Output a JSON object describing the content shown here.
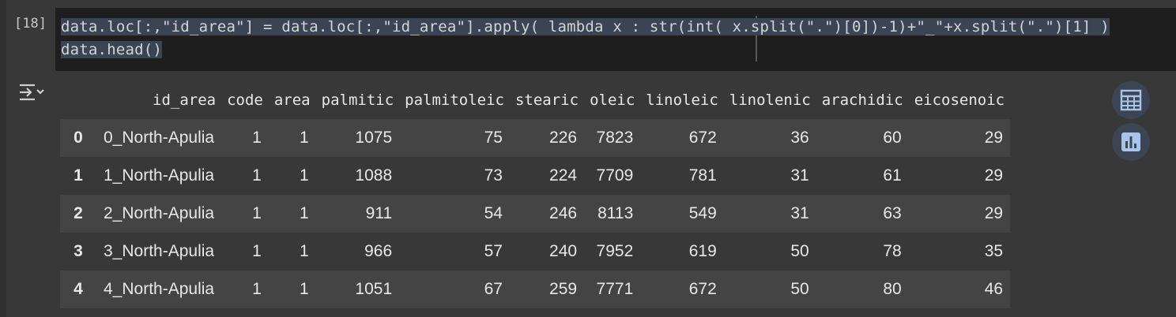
{
  "cell": {
    "execution_count": "[18]",
    "code_line_1": "data.loc[:,\"id_area\"] = data.loc[:,\"id_area\"].apply( lambda x : str(int( x.split(\".\")[0])-1)+\"_\"+x.split(\".\")[1] )",
    "code_line_2": "data.head()"
  },
  "output": {
    "toggle_icon": "output-collapse-icon",
    "columns": [
      "",
      "id_area",
      "code",
      "area",
      "palmitic",
      "palmitoleic",
      "stearic",
      "oleic",
      "linoleic",
      "linolenic",
      "arachidic",
      "eicosenoic"
    ],
    "rows": [
      [
        "0",
        "0_North-Apulia",
        "1",
        "1",
        "1075",
        "75",
        "226",
        "7823",
        "672",
        "36",
        "60",
        "29"
      ],
      [
        "1",
        "1_North-Apulia",
        "1",
        "1",
        "1088",
        "73",
        "224",
        "7709",
        "781",
        "31",
        "61",
        "29"
      ],
      [
        "2",
        "2_North-Apulia",
        "1",
        "1",
        "911",
        "54",
        "246",
        "8113",
        "549",
        "31",
        "63",
        "29"
      ],
      [
        "3",
        "3_North-Apulia",
        "1",
        "1",
        "966",
        "57",
        "240",
        "7952",
        "619",
        "50",
        "78",
        "35"
      ],
      [
        "4",
        "4_North-Apulia",
        "1",
        "1",
        "1051",
        "67",
        "259",
        "7771",
        "672",
        "50",
        "80",
        "46"
      ]
    ]
  },
  "side_buttons": [
    {
      "icon": "table-icon"
    },
    {
      "icon": "bar-chart-icon"
    }
  ],
  "colors": {
    "background": "#383838",
    "code_bg": "#1e1e1e",
    "row_stripe": "#444444",
    "button_bg": "#3b4553",
    "icon_color": "#a9c4ea"
  }
}
